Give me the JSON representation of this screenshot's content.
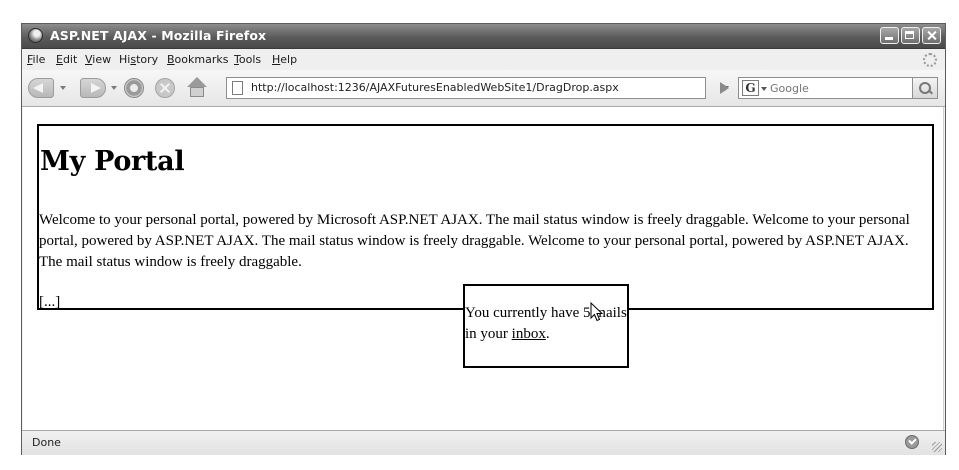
{
  "window": {
    "title": "ASP.NET AJAX - Mozilla Firefox"
  },
  "menu": {
    "items": [
      {
        "accel": "F",
        "rest": "ile"
      },
      {
        "accel": "E",
        "rest": "dit"
      },
      {
        "accel": "V",
        "rest": "iew"
      },
      {
        "pre": "Hi",
        "accel": "s",
        "rest": "tory"
      },
      {
        "accel": "B",
        "rest": "ookmarks"
      },
      {
        "accel": "T",
        "rest": "ools"
      },
      {
        "accel": "H",
        "rest": "elp"
      }
    ]
  },
  "navigation": {
    "url": "http://localhost:1236/AJAXFuturesEnabledWebSite1/DragDrop.aspx",
    "search_engine_letter": "G",
    "search_placeholder": "Google"
  },
  "page": {
    "heading": "My Portal",
    "body": "Welcome to your personal portal, powered by Microsoft ASP.NET AJAX. The mail status window is freely draggable. Welcome to your personal portal, powered by ASP.NET AJAX. The mail status window is freely draggable. Welcome to your personal portal, powered by ASP.NET AJAX. The mail status window is freely draggable.",
    "ellipsis": "[...]",
    "mail": {
      "prefix": "You currently have ",
      "count": "5",
      "middle": " mails in your ",
      "link": "inbox",
      "suffix": "."
    }
  },
  "status": {
    "text": "Done"
  }
}
